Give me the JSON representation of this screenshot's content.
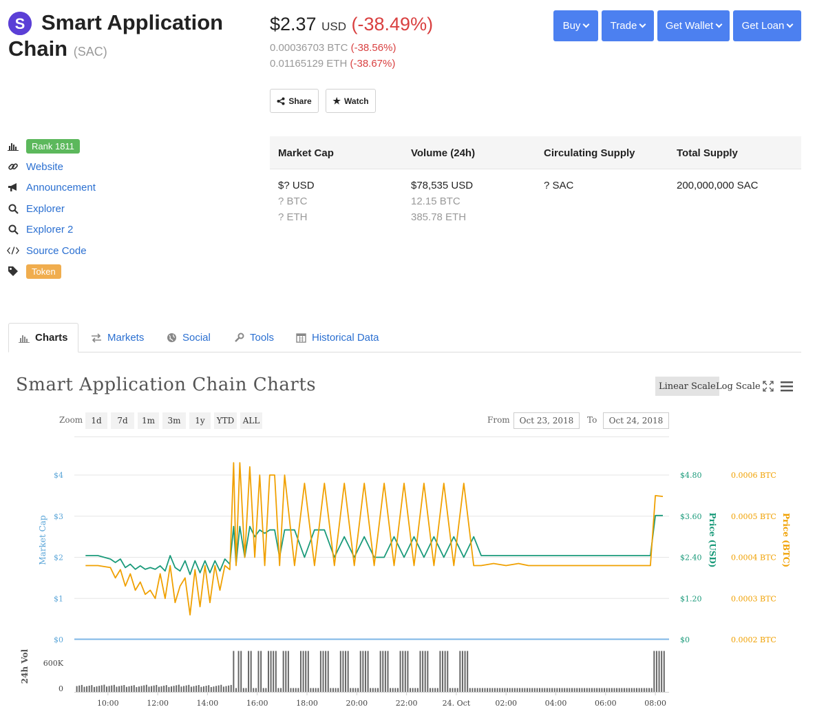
{
  "coin": {
    "name_line1": "Smart Application",
    "name_line2": "Chain",
    "symbol": "(SAC)",
    "price": "$2.37",
    "price_currency": "USD",
    "price_change": "(-38.49%)",
    "btc_price": "0.00036703 BTC",
    "btc_change": "(-38.56%)",
    "eth_price": "0.01165129 ETH",
    "eth_change": "(-38.67%)"
  },
  "actions": {
    "buy": "Buy",
    "trade": "Trade",
    "get_wallet": "Get Wallet",
    "get_loan": "Get Loan",
    "share": "Share",
    "watch": "Watch"
  },
  "sidebar": {
    "rank": "Rank 1811",
    "links": [
      {
        "label": "Website",
        "icon": "link-icon"
      },
      {
        "label": "Announcement",
        "icon": "megaphone-icon"
      },
      {
        "label": "Explorer",
        "icon": "search-icon"
      },
      {
        "label": "Explorer 2",
        "icon": "search-icon"
      },
      {
        "label": "Source Code",
        "icon": "code-icon"
      }
    ],
    "tag": "Token",
    "rank_color": "#5cb85c",
    "tag_color": "#f0ad4e"
  },
  "stats": {
    "headers": [
      "Market Cap",
      "Volume (24h)",
      "Circulating Supply",
      "Total Supply"
    ],
    "market_cap": [
      "$? USD",
      "? BTC",
      "? ETH"
    ],
    "volume": [
      "$78,535 USD",
      "12.15 BTC",
      "385.78 ETH"
    ],
    "circulating": "? SAC",
    "total": "200,000,000 SAC"
  },
  "tabs": [
    {
      "label": "Charts",
      "icon": "bar-chart-icon",
      "active": true
    },
    {
      "label": "Markets",
      "icon": "exchange-icon"
    },
    {
      "label": "Social",
      "icon": "globe-icon"
    },
    {
      "label": "Tools",
      "icon": "wrench-icon"
    },
    {
      "label": "Historical Data",
      "icon": "calendar-icon"
    }
  ],
  "chart_panel": {
    "title": "Smart Application Chain Charts",
    "linear_scale": "Linear Scale",
    "log_scale": "Log Scale",
    "zoom_label": "Zoom",
    "zoom_options": [
      "1d",
      "7d",
      "1m",
      "3m",
      "1y",
      "YTD",
      "ALL"
    ],
    "from_label": "From",
    "from_date": "Oct 23, 2018",
    "to_label": "To",
    "to_date": "Oct 24, 2018"
  },
  "chart_data": {
    "type": "line",
    "x_ticks": [
      "10:00",
      "12:00",
      "14:00",
      "16:00",
      "18:00",
      "20:00",
      "22:00",
      "24. Oct",
      "02:00",
      "04:00",
      "06:00",
      "08:00"
    ],
    "y_left": {
      "label": "Market Cap",
      "ticks": [
        "$0",
        "$1",
        "$2",
        "$3",
        "$4"
      ]
    },
    "y_usd": {
      "label": "Price (USD)",
      "ticks": [
        "$0",
        "$1.20",
        "$2.40",
        "$3.60",
        "$4.80"
      ],
      "ylim": [
        0,
        4.8
      ]
    },
    "y_btc": {
      "label": "Price (BTC)",
      "ticks": [
        "0.0002 BTC",
        "0.0003 BTC",
        "0.0004 BTC",
        "0.0005 BTC",
        "0.0006 BTC"
      ],
      "ylim": [
        0.0002,
        0.0006
      ]
    },
    "volume": {
      "label": "24h Vol",
      "ticks": [
        "0",
        "600K"
      ]
    },
    "series": [
      {
        "name": "Price (USD)",
        "color": "#1a9a7a",
        "x": [
          9.1,
          9.6,
          10.1,
          10.3,
          10.5,
          10.7,
          10.9,
          11.1,
          11.3,
          11.5,
          11.7,
          11.9,
          12.1,
          12.3,
          12.5,
          12.7,
          12.9,
          13.1,
          13.3,
          13.5,
          13.7,
          13.9,
          14.1,
          14.3,
          14.5,
          14.7,
          14.9,
          15.05,
          15.15,
          15.3,
          15.5,
          15.7,
          15.9,
          16.1,
          16.3,
          16.5,
          16.7,
          16.9,
          17.1,
          17.5,
          17.9,
          18.3,
          18.7,
          19.1,
          19.5,
          19.9,
          20.3,
          20.7,
          21.1,
          21.5,
          21.9,
          22.3,
          22.7,
          23.1,
          23.5,
          23.9,
          24.3,
          24.7,
          25.0,
          25.5,
          26.0,
          26.5,
          26.9,
          27.2,
          27.4,
          27.7,
          28.0,
          28.5,
          29.0,
          29.5,
          30.0,
          30.2,
          30.5,
          31.0,
          31.5,
          31.8,
          32.0,
          32.3
        ],
        "y": [
          2.45,
          2.45,
          2.35,
          2.25,
          2.35,
          2.1,
          2.2,
          2.05,
          2.15,
          2.05,
          2.1,
          2.05,
          2.15,
          2.0,
          2.45,
          2.1,
          2.0,
          2.3,
          1.9,
          2.3,
          1.95,
          2.3,
          1.95,
          2.3,
          2.0,
          2.35,
          2.2,
          3.3,
          2.2,
          3.3,
          2.4,
          3.3,
          3.0,
          3.2,
          3.1,
          3.2,
          3.2,
          2.4,
          3.2,
          3.2,
          2.4,
          3.2,
          3.2,
          2.4,
          3.0,
          2.4,
          3.0,
          2.4,
          2.4,
          3.0,
          2.4,
          3.0,
          2.4,
          3.0,
          2.4,
          3.0,
          2.4,
          3.0,
          2.45,
          2.45,
          2.45,
          2.45,
          2.45,
          2.45,
          2.45,
          2.45,
          2.45,
          2.45,
          2.45,
          2.45,
          2.45,
          2.45,
          2.45,
          2.45,
          2.45,
          2.45,
          3.62,
          3.62
        ]
      },
      {
        "name": "Price (BTC)",
        "color": "#f0a000",
        "x": [
          9.1,
          9.6,
          10.1,
          10.3,
          10.5,
          10.7,
          10.9,
          11.1,
          11.3,
          11.5,
          11.7,
          11.9,
          12.1,
          12.3,
          12.5,
          12.7,
          12.9,
          13.1,
          13.3,
          13.5,
          13.7,
          13.9,
          14.1,
          14.3,
          14.5,
          14.7,
          14.9,
          15.05,
          15.15,
          15.3,
          15.5,
          15.7,
          15.9,
          16.1,
          16.3,
          16.5,
          16.7,
          16.9,
          17.1,
          17.5,
          17.9,
          18.3,
          18.7,
          19.1,
          19.5,
          19.9,
          20.3,
          20.7,
          21.1,
          21.5,
          21.9,
          22.3,
          22.7,
          23.1,
          23.5,
          23.9,
          24.3,
          24.7,
          25.0,
          25.5,
          26.0,
          26.5,
          26.9,
          27.2,
          27.4,
          27.7,
          28.0,
          28.5,
          29.0,
          29.5,
          30.0,
          30.2,
          30.5,
          31.0,
          31.5,
          31.8,
          32.0,
          32.3
        ],
        "y": [
          0.00038,
          0.00038,
          0.000375,
          0.00035,
          0.00037,
          0.00033,
          0.00036,
          0.00032,
          0.00034,
          0.00031,
          0.00032,
          0.0003,
          0.00036,
          0.0003,
          0.00038,
          0.00029,
          0.00033,
          0.00035,
          0.00026,
          0.00037,
          0.00028,
          0.00038,
          0.00029,
          0.00038,
          0.00032,
          0.00038,
          0.00037,
          0.00063,
          0.00038,
          0.00063,
          0.0004,
          0.00062,
          0.0004,
          0.0006,
          0.00038,
          0.0006,
          0.0006,
          0.00038,
          0.0006,
          0.00038,
          0.00058,
          0.00038,
          0.00058,
          0.00038,
          0.00058,
          0.00038,
          0.00058,
          0.00038,
          0.00058,
          0.00038,
          0.00058,
          0.00038,
          0.00058,
          0.00038,
          0.00058,
          0.00038,
          0.00058,
          0.00038,
          0.00038,
          0.000385,
          0.00038,
          0.000385,
          0.00038,
          0.00038,
          0.00038,
          0.00038,
          0.00038,
          0.00038,
          0.00038,
          0.00038,
          0.00038,
          0.00038,
          0.00038,
          0.00038,
          0.00038,
          0.00038,
          0.00055,
          0.000548
        ]
      }
    ]
  }
}
